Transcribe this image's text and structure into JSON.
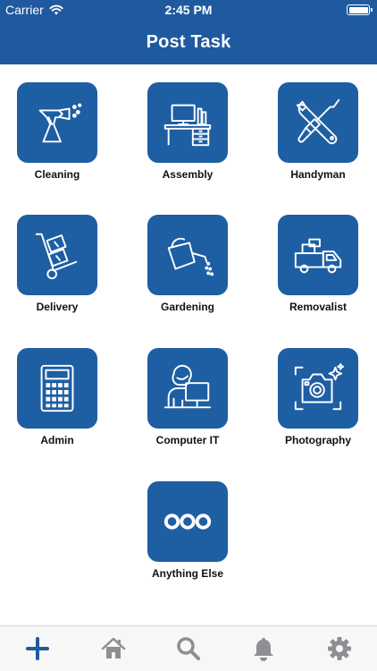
{
  "status_bar": {
    "carrier": "Carrier",
    "time": "2:45 PM"
  },
  "header": {
    "title": "Post Task"
  },
  "categories": [
    {
      "label": "Cleaning",
      "icon": "spray-bottle-icon"
    },
    {
      "label": "Assembly",
      "icon": "desk-computer-icon"
    },
    {
      "label": "Handyman",
      "icon": "wrench-screwdriver-icon"
    },
    {
      "label": "Delivery",
      "icon": "hand-truck-icon"
    },
    {
      "label": "Gardening",
      "icon": "watering-can-icon"
    },
    {
      "label": "Removalist",
      "icon": "moving-truck-icon"
    },
    {
      "label": "Admin",
      "icon": "calculator-icon"
    },
    {
      "label": "Computer IT",
      "icon": "person-at-computer-icon"
    },
    {
      "label": "Photography",
      "icon": "camera-icon"
    },
    {
      "label": "Anything Else",
      "icon": "more-dots-icon"
    }
  ],
  "tab_bar": {
    "tabs": [
      {
        "icon": "plus-icon",
        "active": true
      },
      {
        "icon": "home-icon",
        "active": false
      },
      {
        "icon": "search-icon",
        "active": false
      },
      {
        "icon": "bell-icon",
        "active": false
      },
      {
        "icon": "gear-icon",
        "active": false
      }
    ]
  },
  "colors": {
    "brand": "#1f5aa0",
    "tile": "#1e5ea3",
    "tab_active": "#1f5aa0",
    "tab_inactive": "#8e8e93"
  }
}
